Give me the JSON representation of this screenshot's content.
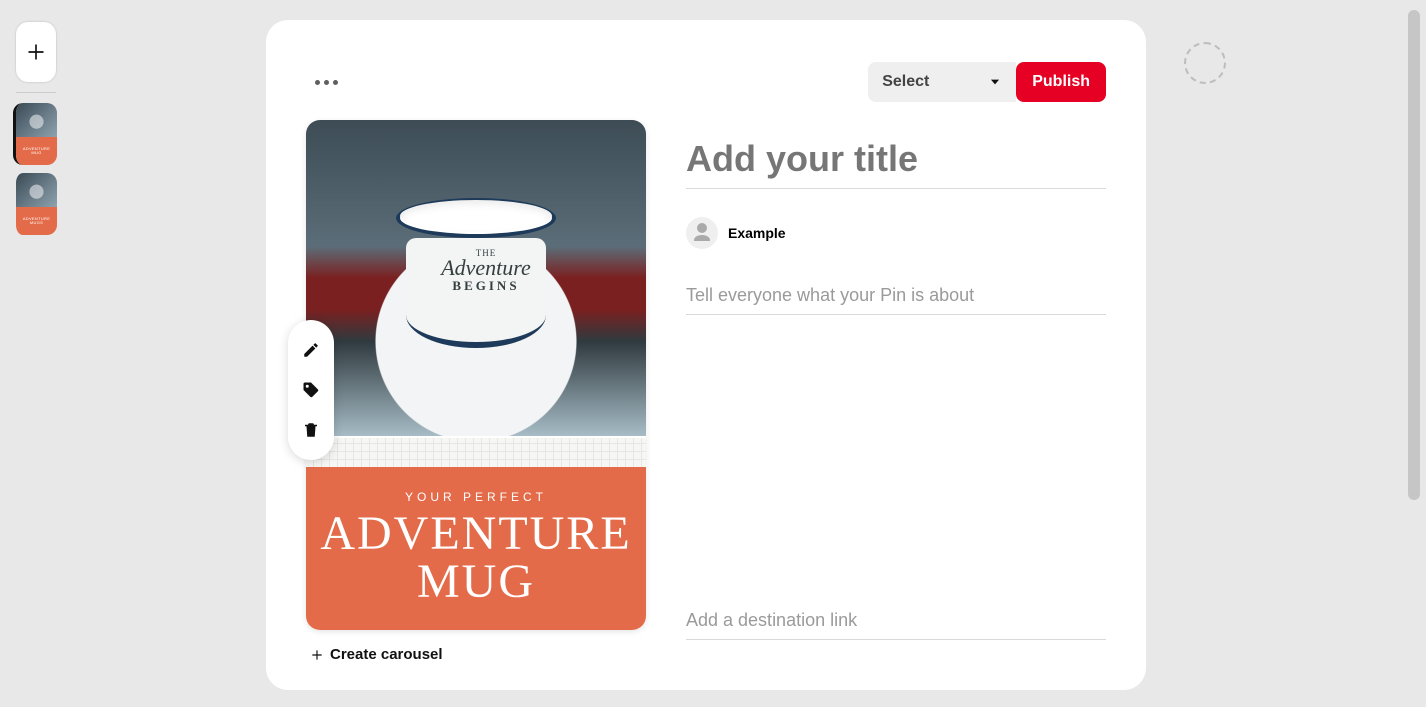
{
  "leftRail": {
    "thumbs": [
      {
        "kicker": "ADVENTURE",
        "sub": "MUG",
        "selected": true
      },
      {
        "kicker": "ADVENTURE",
        "sub": "MUGS",
        "selected": false
      }
    ]
  },
  "header": {
    "select_label": "Select",
    "publish_label": "Publish"
  },
  "preview": {
    "mug_the": "THE",
    "mug_adventure": "Adventure",
    "mug_begins": "BEGINS",
    "kicker": "YOUR PERFECT",
    "title_line1": "ADVENTURE",
    "title_line2": "MUG"
  },
  "carousel_label": "Create carousel",
  "form": {
    "title_placeholder": "Add your title",
    "title_value": "",
    "author_name": "Example",
    "desc_placeholder": "Tell everyone what your Pin is about",
    "desc_value": "",
    "link_placeholder": "Add a destination link",
    "link_value": ""
  }
}
